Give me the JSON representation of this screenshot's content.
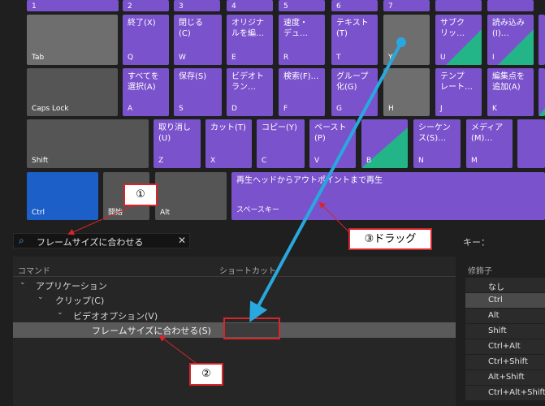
{
  "keyboard": {
    "row0": [
      "1",
      "2",
      "3",
      "4",
      "5",
      "6",
      "7"
    ],
    "q_row": [
      {
        "text": "",
        "key": "Tab"
      },
      {
        "text": "終了(X)",
        "key": "Q"
      },
      {
        "text": "閉じる\n(C)",
        "key": "W"
      },
      {
        "text": "オリジナ\nルを編…",
        "key": "E"
      },
      {
        "text": "速度・\nデュ…",
        "key": "R"
      },
      {
        "text": "テキスト\n(T)",
        "key": "T"
      },
      {
        "text": "",
        "key": "Y"
      },
      {
        "text": "サブク\nリッ…",
        "key": "U"
      },
      {
        "text": "読み込み\n(I)…",
        "key": "I"
      }
    ],
    "a_row": [
      {
        "text": "",
        "key": "Caps Lock"
      },
      {
        "text": "すべてを\n選択(A)",
        "key": "A"
      },
      {
        "text": "保存(S)",
        "key": "S"
      },
      {
        "text": "ビデオト\nラン…",
        "key": "D"
      },
      {
        "text": "検索(F)…",
        "key": "F"
      },
      {
        "text": "グループ\n化(G)",
        "key": "G"
      },
      {
        "text": "",
        "key": "H"
      },
      {
        "text": "テンプ\nレート…",
        "key": "J"
      },
      {
        "text": "編集点を\n追加(A)",
        "key": "K"
      }
    ],
    "z_row": [
      {
        "text": "",
        "key": "Shift"
      },
      {
        "text": "取り消し\n(U)",
        "key": "Z"
      },
      {
        "text": "カット(T)",
        "key": "X"
      },
      {
        "text": "コピー(Y)",
        "key": "C"
      },
      {
        "text": "ペースト\n(P)",
        "key": "V"
      },
      {
        "text": "",
        "key": "B"
      },
      {
        "text": "シーケン\nス(S)…",
        "key": "N"
      },
      {
        "text": "メディア\n(M)…",
        "key": "M"
      }
    ],
    "bottom_row": [
      {
        "text": "",
        "key": "Ctrl"
      },
      {
        "text": "",
        "key": "開始"
      },
      {
        "text": "",
        "key": "Alt"
      },
      {
        "text": "再生ヘッドからアウトポイントまで再生",
        "key": "スペースキー"
      }
    ]
  },
  "search": {
    "icon": "search-icon",
    "value": "フレームサイズに合わせる",
    "clear_icon": "close-icon"
  },
  "key_label": "キー：",
  "table": {
    "col_command": "コマンド",
    "col_shortcut": "ショートカット",
    "rows": [
      {
        "label": "アプリケーション"
      },
      {
        "label": "クリップ(C)"
      },
      {
        "label": "ビデオオプション(V)"
      },
      {
        "label": "フレームサイズに合わせる(S)"
      }
    ]
  },
  "modifiers": {
    "header": "修飾子",
    "items": [
      "なし",
      "Ctrl",
      "Alt",
      "Shift",
      "Ctrl+Alt",
      "Ctrl+Shift",
      "Alt+Shift",
      "Ctrl+Alt+Shift"
    ]
  },
  "callouts": {
    "one": "①",
    "two": "②",
    "three": "③ドラッグ"
  },
  "colors": {
    "assigned": "#7a52cc",
    "selected_key": "#1c5fc9",
    "unassigned": "#6e6e6e",
    "annotation_red": "#d4262b",
    "arrow_blue": "#29a8e0",
    "split_green": "#23b487"
  }
}
